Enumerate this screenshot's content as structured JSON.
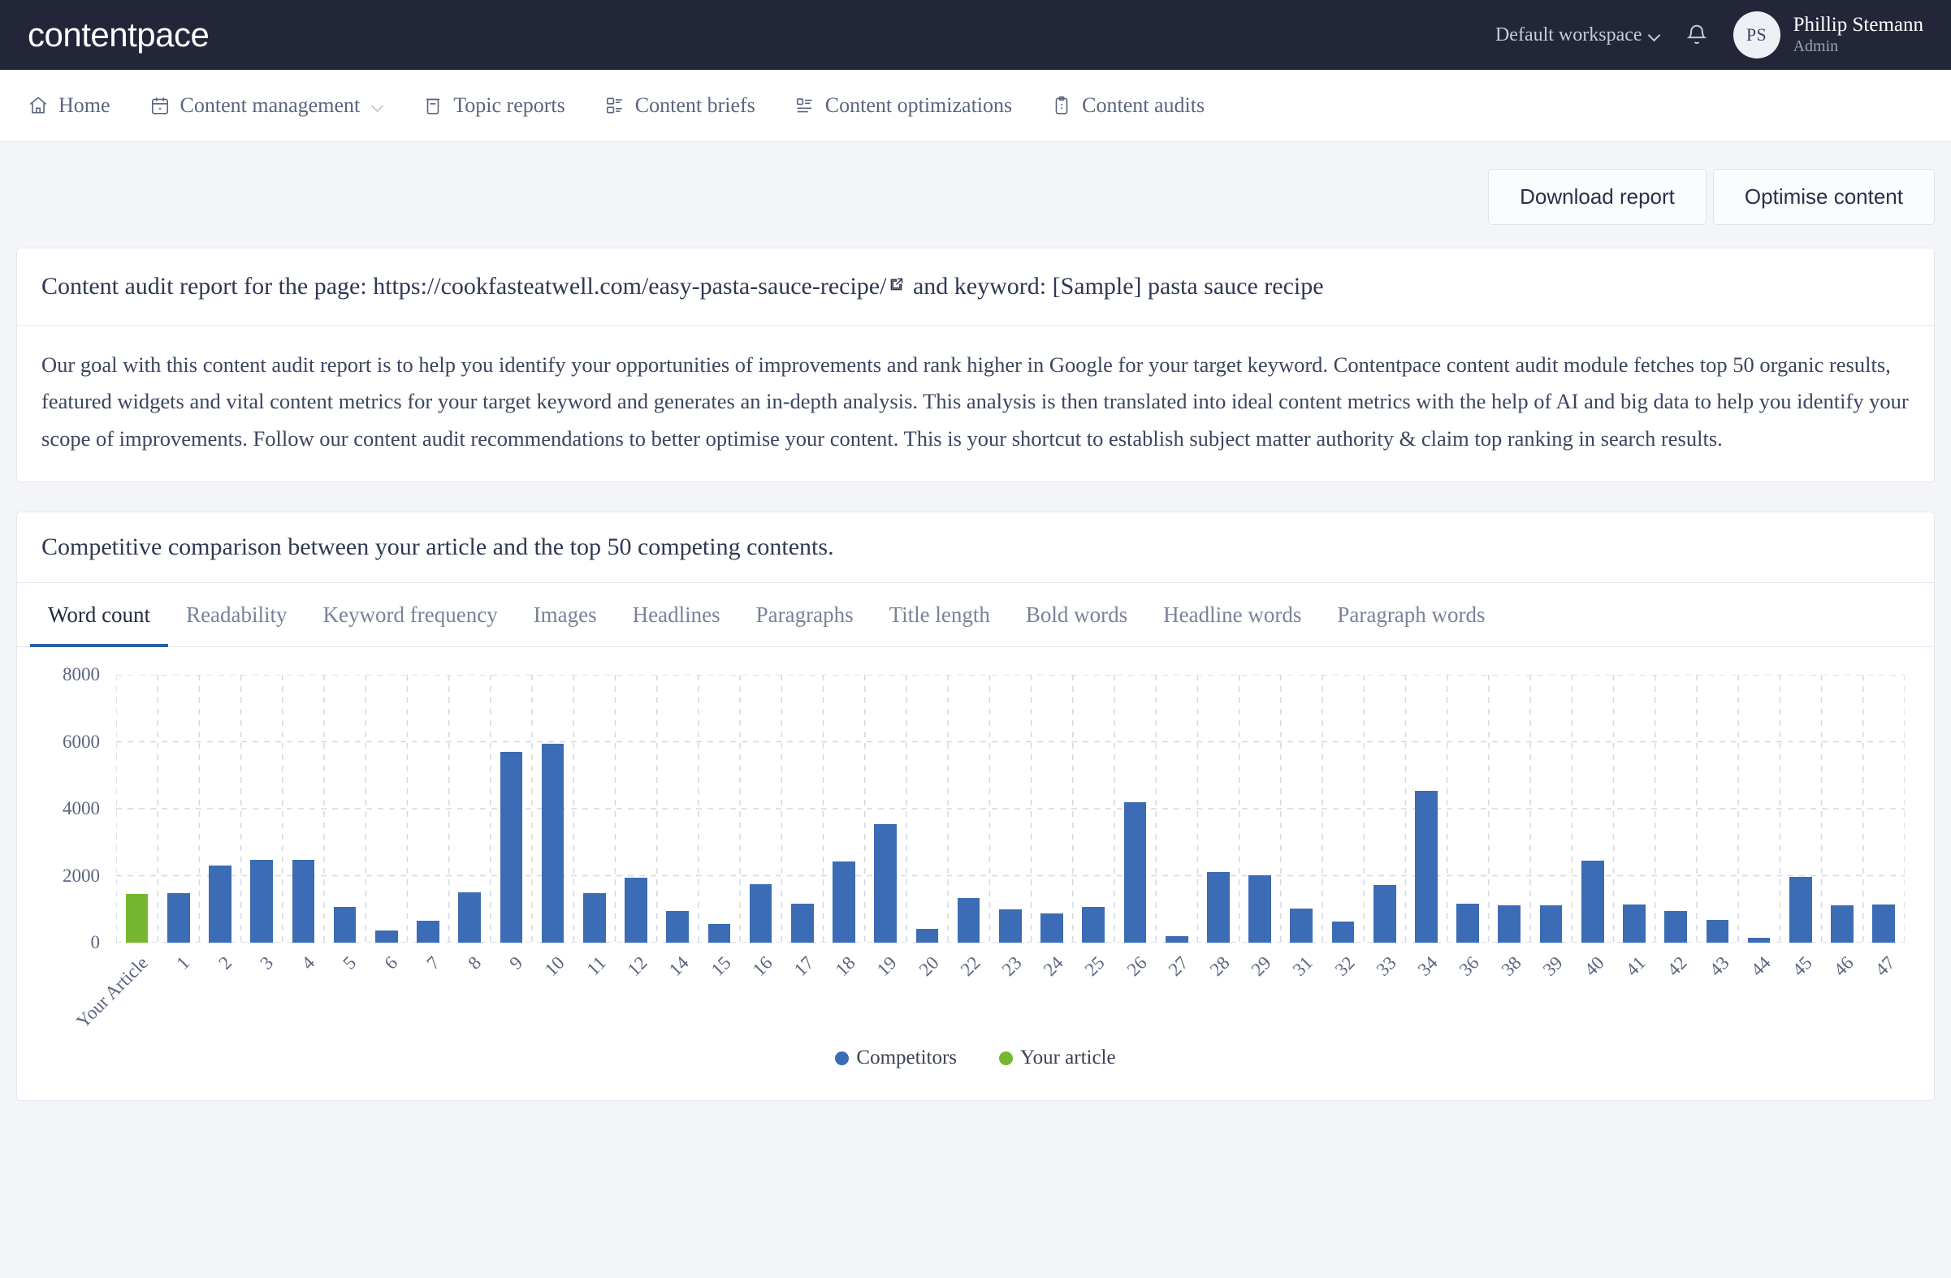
{
  "brand": {
    "logo_text": "contentpace"
  },
  "topbar": {
    "workspace_label": "Default workspace",
    "notification_icon": "bell-icon",
    "user": {
      "initials": "PS",
      "name": "Phillip Stemann",
      "role": "Admin"
    }
  },
  "nav": {
    "items": [
      {
        "label": "Home",
        "icon": "home-icon"
      },
      {
        "label": "Content management",
        "icon": "calendar-icon",
        "caret": true
      },
      {
        "label": "Topic reports",
        "icon": "report-icon"
      },
      {
        "label": "Content briefs",
        "icon": "brief-icon"
      },
      {
        "label": "Content optimizations",
        "icon": "list-icon"
      },
      {
        "label": "Content audits",
        "icon": "clipboard-icon"
      }
    ]
  },
  "toolbar": {
    "download_label": "Download report",
    "optimise_label": "Optimise content"
  },
  "report": {
    "title_prefix": "Content audit report for the page: ",
    "url": "https://cookfasteatwell.com/easy-pasta-sauce-recipe/",
    "title_suffix": " and keyword: [Sample] pasta sauce recipe",
    "description": "Our goal with this content audit report is to help you identify your opportunities of improvements and rank higher in Google for your target keyword. Contentpace content audit module fetches top 50 organic results, featured widgets and vital content metrics for your target keyword and generates an in-depth analysis. This analysis is then translated into ideal content metrics with the help of AI and big data to help you identify your scope of improvements. Follow our content audit recommendations to better optimise your content. This is your shortcut to establish subject matter authority & claim top ranking in search results."
  },
  "comparison": {
    "heading": "Competitive comparison between your article and the top 50 competing contents.",
    "tabs": [
      {
        "label": "Word count",
        "active": true
      },
      {
        "label": "Readability",
        "active": false
      },
      {
        "label": "Keyword frequency",
        "active": false
      },
      {
        "label": "Images",
        "active": false
      },
      {
        "label": "Headlines",
        "active": false
      },
      {
        "label": "Paragraphs",
        "active": false
      },
      {
        "label": "Title length",
        "active": false
      },
      {
        "label": "Bold words",
        "active": false
      },
      {
        "label": "Headline words",
        "active": false
      },
      {
        "label": "Paragraph words",
        "active": false
      }
    ]
  },
  "chart_data": {
    "type": "bar",
    "title": "",
    "xlabel": "",
    "ylabel": "",
    "ylim": [
      0,
      8000
    ],
    "yticks": [
      0,
      2000,
      4000,
      6000,
      8000
    ],
    "grid": true,
    "legend_position": "bottom",
    "legend": [
      {
        "name": "Competitors",
        "color": "#3b6cb5"
      },
      {
        "name": "Your article",
        "color": "#76b731"
      }
    ],
    "colors": {
      "competitor": "#3b6cb5",
      "mine": "#76b731"
    },
    "categories": [
      "Your Article",
      "1",
      "2",
      "3",
      "4",
      "5",
      "6",
      "7",
      "8",
      "9",
      "10",
      "11",
      "12",
      "14",
      "15",
      "16",
      "17",
      "18",
      "19",
      "20",
      "22",
      "23",
      "24",
      "25",
      "26",
      "27",
      "28",
      "29",
      "31",
      "32",
      "33",
      "34",
      "36",
      "38",
      "39",
      "40",
      "41",
      "42",
      "43",
      "44",
      "45",
      "46",
      "47"
    ],
    "values": [
      1450,
      1480,
      2300,
      2480,
      2470,
      1070,
      370,
      670,
      1500,
      5700,
      5950,
      1480,
      1950,
      960,
      560,
      1740,
      1180,
      2430,
      3550,
      420,
      1350,
      1010,
      870,
      1080,
      4200,
      200,
      2120,
      2020,
      1030,
      640,
      1720,
      4550,
      1160,
      1120,
      1130,
      2460,
      1150,
      950,
      690,
      140,
      1970,
      1130,
      1140
    ],
    "series_of_point": [
      "mine",
      "competitor",
      "competitor",
      "competitor",
      "competitor",
      "competitor",
      "competitor",
      "competitor",
      "competitor",
      "competitor",
      "competitor",
      "competitor",
      "competitor",
      "competitor",
      "competitor",
      "competitor",
      "competitor",
      "competitor",
      "competitor",
      "competitor",
      "competitor",
      "competitor",
      "competitor",
      "competitor",
      "competitor",
      "competitor",
      "competitor",
      "competitor",
      "competitor",
      "competitor",
      "competitor",
      "competitor",
      "competitor",
      "competitor",
      "competitor",
      "competitor",
      "competitor",
      "competitor",
      "competitor",
      "competitor",
      "competitor",
      "competitor",
      "competitor"
    ]
  }
}
